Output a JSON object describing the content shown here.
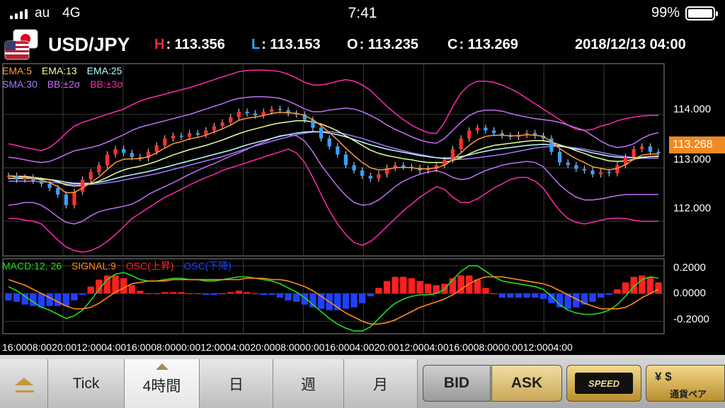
{
  "status": {
    "carrier": "au",
    "network": "4G",
    "time": "7:41",
    "battery": "99%"
  },
  "header": {
    "pair": "USD/JPY",
    "high": {
      "key": "H",
      "value": ": 113.356",
      "color": "#ff2a2a"
    },
    "low": {
      "key": "L",
      "value": ": 113.153",
      "color": "#2aa8ff"
    },
    "open": {
      "key": "O",
      "value": ": 113.235"
    },
    "close": {
      "key": "C",
      "value": ": 113.269"
    },
    "datetime": "2018/12/13 04:00"
  },
  "indicators": {
    "ema5": {
      "label": "EMA:5",
      "color": "#ff9a3c"
    },
    "ema13": {
      "label": "EMA:13",
      "color": "#e8ff9a"
    },
    "ema25": {
      "label": "EMA:25",
      "color": "#b8ffff"
    },
    "sma30": {
      "label": "SMA:30",
      "color": "#a878ff"
    },
    "bb2": {
      "label": "BB:±2σ",
      "color": "#c070f0"
    },
    "bb3": {
      "label": "BB:±3σ",
      "color": "#ff2ab0"
    }
  },
  "macd": {
    "macd": {
      "label": "MACD:12, 26",
      "color": "#22dd22"
    },
    "signal": {
      "label": "SIGNAL:9",
      "color": "#ff8a1a"
    },
    "osc_up": {
      "label": "OSC(上昇)",
      "color": "#ff2020"
    },
    "osc_down": {
      "label": "OSC(下降)",
      "color": "#2040ff"
    }
  },
  "price_axis": [
    "114.000",
    "113.000",
    "112.000"
  ],
  "current_price": "113.268",
  "macd_axis": [
    "0.2000",
    "0.0000",
    "-0.2000"
  ],
  "time_axis": "16:0008:0020:0012:0004:0016:0008:0000:0012:0004:0020:0008:0000:0016:0004:0020:0012:0004:0016:0008:0000:0012:0004:00",
  "tabs": {
    "home": "",
    "tick": "Tick",
    "h4": "4時間",
    "day": "日",
    "week": "週",
    "month": "月"
  },
  "buttons": {
    "bid": "BID",
    "ask": "ASK",
    "speed": "SPEED",
    "pair": "通貨ペア",
    "pair_symbols": "¥ $"
  },
  "chart_data": {
    "type": "line",
    "price_range": [
      111.35,
      114.95
    ],
    "macd_range": [
      -0.29,
      0.25
    ],
    "close": [
      112.85,
      112.78,
      112.82,
      112.76,
      112.7,
      112.62,
      112.5,
      112.3,
      112.55,
      112.78,
      112.92,
      113.05,
      113.25,
      113.35,
      113.28,
      113.2,
      113.18,
      113.3,
      113.42,
      113.55,
      113.6,
      113.58,
      113.65,
      113.62,
      113.7,
      113.78,
      113.85,
      113.95,
      114.05,
      114.02,
      113.98,
      114.05,
      114.1,
      114.08,
      114.02,
      114.0,
      113.9,
      113.75,
      113.55,
      113.4,
      113.25,
      113.05,
      112.95,
      112.85,
      112.8,
      112.88,
      113.0,
      113.05,
      113.02,
      113.0,
      112.95,
      112.98,
      113.05,
      113.15,
      113.35,
      113.55,
      113.7,
      113.75,
      113.7,
      113.65,
      113.6,
      113.58,
      113.62,
      113.65,
      113.6,
      113.55,
      113.3,
      113.1,
      113.05,
      112.98,
      112.95,
      112.88,
      112.92,
      112.9,
      113.05,
      113.2,
      113.35,
      113.4,
      113.3,
      113.27
    ],
    "ema5": [
      112.85,
      112.82,
      112.82,
      112.8,
      112.77,
      112.72,
      112.65,
      112.53,
      112.54,
      112.62,
      112.72,
      112.83,
      112.97,
      113.1,
      113.16,
      113.17,
      113.17,
      113.21,
      113.28,
      113.37,
      113.45,
      113.49,
      113.54,
      113.57,
      113.61,
      113.67,
      113.73,
      113.8,
      113.89,
      113.93,
      113.95,
      113.98,
      114.02,
      114.04,
      114.03,
      114.02,
      113.98,
      113.9,
      113.79,
      113.66,
      113.52,
      113.37,
      113.23,
      113.1,
      113.0,
      112.96,
      112.97,
      113.0,
      113.01,
      113.0,
      112.98,
      112.98,
      113.0,
      113.05,
      113.15,
      113.28,
      113.42,
      113.53,
      113.59,
      113.61,
      113.61,
      113.6,
      113.6,
      113.62,
      113.61,
      113.59,
      113.49,
      113.36,
      113.26,
      113.17,
      113.1,
      113.02,
      112.99,
      112.96,
      112.99,
      113.06,
      113.16,
      113.24,
      113.26,
      113.26
    ],
    "ema13": [
      112.85,
      112.84,
      112.84,
      112.82,
      112.8,
      112.78,
      112.74,
      112.68,
      112.66,
      112.67,
      112.7,
      112.75,
      112.82,
      112.9,
      112.96,
      113.0,
      113.03,
      113.07,
      113.12,
      113.18,
      113.24,
      113.29,
      113.34,
      113.38,
      113.42,
      113.47,
      113.52,
      113.58,
      113.64,
      113.69,
      113.73,
      113.77,
      113.81,
      113.84,
      113.86,
      113.88,
      113.88,
      113.86,
      113.82,
      113.76,
      113.69,
      113.6,
      113.51,
      113.42,
      113.33,
      113.27,
      113.23,
      113.2,
      113.17,
      113.15,
      113.12,
      113.1,
      113.1,
      113.1,
      113.14,
      113.19,
      113.26,
      113.33,
      113.38,
      113.42,
      113.44,
      113.46,
      113.48,
      113.5,
      113.51,
      113.51,
      113.48,
      113.43,
      113.38,
      113.32,
      113.27,
      113.21,
      113.17,
      113.13,
      113.12,
      113.13,
      113.16,
      113.19,
      113.21,
      113.22
    ],
    "ema25": [
      112.8,
      112.8,
      112.8,
      112.8,
      112.79,
      112.78,
      112.76,
      112.73,
      112.71,
      112.71,
      112.71,
      112.73,
      112.76,
      112.8,
      112.84,
      112.87,
      112.9,
      112.93,
      112.97,
      113.01,
      113.05,
      113.09,
      113.13,
      113.17,
      113.21,
      113.25,
      113.29,
      113.33,
      113.38,
      113.43,
      113.47,
      113.51,
      113.55,
      113.59,
      113.62,
      113.65,
      113.67,
      113.68,
      113.67,
      113.65,
      113.62,
      113.58,
      113.53,
      113.48,
      113.43,
      113.39,
      113.35,
      113.32,
      113.29,
      113.26,
      113.23,
      113.21,
      113.19,
      113.18,
      113.19,
      113.21,
      113.24,
      113.28,
      113.31,
      113.34,
      113.36,
      113.38,
      113.4,
      113.42,
      113.43,
      113.44,
      113.43,
      113.41,
      113.38,
      113.35,
      113.32,
      113.28,
      113.25,
      113.22,
      113.2,
      113.19,
      113.19,
      113.2,
      113.21,
      113.21
    ],
    "sma30": [
      112.75,
      112.75,
      112.75,
      112.75,
      112.74,
      112.73,
      112.72,
      112.7,
      112.69,
      112.69,
      112.69,
      112.7,
      112.72,
      112.74,
      112.77,
      112.8,
      112.83,
      112.86,
      112.89,
      112.93,
      112.97,
      113.01,
      113.05,
      113.09,
      113.13,
      113.17,
      113.21,
      113.26,
      113.31,
      113.36,
      113.41,
      113.45,
      113.5,
      113.54,
      113.58,
      113.62,
      113.65,
      113.67,
      113.68,
      113.68,
      113.66,
      113.63,
      113.59,
      113.55,
      113.5,
      113.45,
      113.4,
      113.36,
      113.32,
      113.28,
      113.25,
      113.22,
      113.19,
      113.17,
      113.16,
      113.16,
      113.17,
      113.19,
      113.21,
      113.23,
      113.25,
      113.28,
      113.31,
      113.34,
      113.37,
      113.39,
      113.4,
      113.4,
      113.39,
      113.37,
      113.35,
      113.32,
      113.29,
      113.26,
      113.23,
      113.21,
      113.19,
      113.18,
      113.18,
      113.18
    ],
    "bb2_upper": [
      113.2,
      113.18,
      113.15,
      113.12,
      113.1,
      113.12,
      113.18,
      113.25,
      113.32,
      113.35,
      113.38,
      113.42,
      113.48,
      113.55,
      113.62,
      113.7,
      113.76,
      113.8,
      113.84,
      113.88,
      113.92,
      113.96,
      114.0,
      114.05,
      114.1,
      114.15,
      114.2,
      114.26,
      114.3,
      114.32,
      114.33,
      114.33,
      114.32,
      114.3,
      114.25,
      114.18,
      114.1,
      114.05,
      114.05,
      114.08,
      114.1,
      114.12,
      114.1,
      114.05,
      113.98,
      113.9,
      113.8,
      113.72,
      113.65,
      113.58,
      113.52,
      113.48,
      113.46,
      113.55,
      113.7,
      113.85,
      113.98,
      114.05,
      114.08,
      114.08,
      114.06,
      114.02,
      113.98,
      113.95,
      113.92,
      113.9,
      113.88,
      113.85,
      113.8,
      113.75,
      113.7,
      113.6,
      113.5,
      113.42,
      113.38,
      113.4,
      113.45,
      113.55,
      113.62,
      113.66
    ],
    "bb2_lower": [
      112.3,
      112.32,
      112.35,
      112.35,
      112.3,
      112.2,
      112.08,
      111.98,
      111.95,
      112.0,
      112.1,
      112.18,
      112.22,
      112.25,
      112.28,
      112.32,
      112.4,
      112.5,
      112.58,
      112.65,
      112.72,
      112.8,
      112.88,
      112.95,
      113.02,
      113.08,
      113.15,
      113.22,
      113.28,
      113.35,
      113.42,
      113.48,
      113.55,
      113.6,
      113.62,
      113.6,
      113.5,
      113.3,
      113.05,
      112.85,
      112.65,
      112.48,
      112.35,
      112.3,
      112.32,
      112.4,
      112.52,
      112.65,
      112.75,
      112.82,
      112.88,
      112.92,
      112.95,
      112.9,
      112.82,
      112.78,
      112.8,
      112.88,
      112.95,
      113.0,
      113.05,
      113.08,
      113.1,
      113.12,
      113.1,
      113.02,
      112.85,
      112.68,
      112.55,
      112.45,
      112.4,
      112.4,
      112.42,
      112.45,
      112.48,
      112.5,
      112.5,
      112.5,
      112.5,
      112.5
    ],
    "bb3_upper": [
      113.45,
      113.42,
      113.38,
      113.35,
      113.32,
      113.38,
      113.5,
      113.65,
      113.78,
      113.85,
      113.9,
      113.95,
      114.0,
      114.05,
      114.1,
      114.18,
      114.25,
      114.3,
      114.34,
      114.38,
      114.42,
      114.46,
      114.5,
      114.55,
      114.6,
      114.65,
      114.7,
      114.75,
      114.8,
      114.82,
      114.83,
      114.83,
      114.82,
      114.8,
      114.75,
      114.68,
      114.6,
      114.55,
      114.55,
      114.58,
      114.62,
      114.65,
      114.62,
      114.55,
      114.45,
      114.3,
      114.15,
      114.02,
      113.9,
      113.8,
      113.72,
      113.66,
      113.64,
      113.85,
      114.15,
      114.4,
      114.55,
      114.62,
      114.62,
      114.6,
      114.55,
      114.48,
      114.4,
      114.3,
      114.2,
      114.1,
      114.0,
      113.9,
      113.8,
      113.72,
      113.7,
      113.72,
      113.78,
      113.82,
      113.88,
      113.92,
      113.95,
      113.97,
      113.98,
      113.98
    ],
    "bb3_lower": [
      112.05,
      112.05,
      112.02,
      112.0,
      111.95,
      111.8,
      111.65,
      111.52,
      111.45,
      111.42,
      111.45,
      111.52,
      111.62,
      111.75,
      111.9,
      112.05,
      112.15,
      112.25,
      112.35,
      112.45,
      112.52,
      112.6,
      112.68,
      112.75,
      112.82,
      112.88,
      112.95,
      113.0,
      113.05,
      113.1,
      113.15,
      113.2,
      113.25,
      113.3,
      113.35,
      113.28,
      113.1,
      112.82,
      112.5,
      112.2,
      111.95,
      111.75,
      111.6,
      111.55,
      111.62,
      111.75,
      111.9,
      112.05,
      112.2,
      112.32,
      112.45,
      112.55,
      112.65,
      112.6,
      112.45,
      112.35,
      112.35,
      112.42,
      112.52,
      112.62,
      112.7,
      112.78,
      112.82,
      112.82,
      112.75,
      112.62,
      112.4,
      112.2,
      112.05,
      111.98,
      111.95,
      111.98,
      112.02,
      112.05,
      112.06,
      112.05,
      112.02,
      112.0,
      112.0,
      112.0
    ],
    "macd_line": [
      0.05,
      0.02,
      -0.02,
      -0.06,
      -0.1,
      -0.12,
      -0.15,
      -0.18,
      -0.16,
      -0.12,
      -0.05,
      0.03,
      0.1,
      0.14,
      0.15,
      0.13,
      0.1,
      0.09,
      0.09,
      0.1,
      0.11,
      0.11,
      0.1,
      0.1,
      0.09,
      0.09,
      0.1,
      0.11,
      0.12,
      0.12,
      0.11,
      0.1,
      0.09,
      0.07,
      0.04,
      0.01,
      -0.03,
      -0.08,
      -0.13,
      -0.18,
      -0.22,
      -0.25,
      -0.27,
      -0.27,
      -0.24,
      -0.18,
      -0.12,
      -0.07,
      -0.04,
      -0.02,
      -0.01,
      -0.01,
      0.0,
      0.03,
      0.1,
      0.16,
      0.2,
      0.2,
      0.16,
      0.12,
      0.09,
      0.08,
      0.07,
      0.06,
      0.05,
      0.03,
      -0.02,
      -0.08,
      -0.12,
      -0.14,
      -0.15,
      -0.15,
      -0.14,
      -0.12,
      -0.08,
      -0.02,
      0.05,
      0.1,
      0.12,
      0.11
    ],
    "signal_line": [
      0.1,
      0.08,
      0.06,
      0.03,
      0.0,
      -0.03,
      -0.06,
      -0.09,
      -0.11,
      -0.11,
      -0.1,
      -0.07,
      -0.03,
      0.01,
      0.04,
      0.07,
      0.08,
      0.09,
      0.09,
      0.09,
      0.1,
      0.1,
      0.1,
      0.1,
      0.1,
      0.1,
      0.1,
      0.1,
      0.1,
      0.11,
      0.11,
      0.11,
      0.1,
      0.1,
      0.09,
      0.07,
      0.05,
      0.02,
      -0.02,
      -0.06,
      -0.1,
      -0.14,
      -0.17,
      -0.2,
      -0.22,
      -0.22,
      -0.21,
      -0.19,
      -0.16,
      -0.13,
      -0.1,
      -0.08,
      -0.06,
      -0.04,
      -0.01,
      0.03,
      0.07,
      0.1,
      0.12,
      0.12,
      0.12,
      0.11,
      0.1,
      0.09,
      0.08,
      0.07,
      0.05,
      0.02,
      -0.01,
      -0.04,
      -0.07,
      -0.09,
      -0.11,
      -0.11,
      -0.11,
      -0.1,
      -0.07,
      -0.03,
      0.0,
      0.03
    ]
  }
}
